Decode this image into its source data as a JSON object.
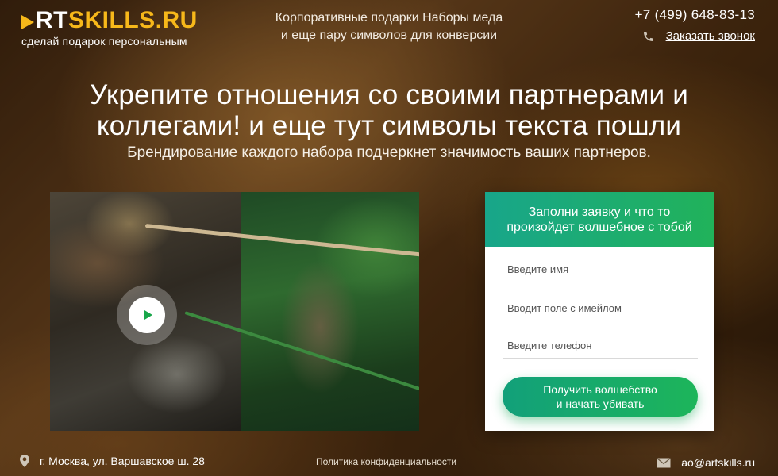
{
  "logo": {
    "word_white": "RT",
    "word_yellow": "SKILLS.RU",
    "tagline": "сделай подарок персональным",
    "accent_color": "#f7b81a"
  },
  "header": {
    "line1": "Корпоративные подарки Наборы меда",
    "line2": "и еще пару символов для конверсии",
    "phone": "+7 (499) 648-83-13",
    "callback_label": "Заказать звонок",
    "phone_icon": "phone-icon"
  },
  "hero": {
    "title_line1": "Укрепите отношения со своими партнерами и",
    "title_line2": "коллегами! и еще тут символы текста пошли",
    "subtitle": "Брендирование каждого набора подчеркнет значимость ваших партнеров."
  },
  "video": {
    "play_icon": "play-icon"
  },
  "form": {
    "header_line1": "Заполни заявку и что то",
    "header_line2": "произойдет волшебное с тобой",
    "name_placeholder": "Введите имя",
    "email_placeholder": "Вводит поле с имейлом",
    "phone_placeholder": "Введите телефон",
    "submit_line1": "Получить волшебство",
    "submit_line2": "и начать убивать",
    "accent_color": "#1db55a"
  },
  "footer": {
    "address": "г. Москва, ул. Варшавское ш. 28",
    "privacy_link": "Политика конфиденциальности",
    "email": "ao@artskills.ru",
    "location_icon": "location-pin-icon",
    "mail_icon": "mail-icon"
  }
}
